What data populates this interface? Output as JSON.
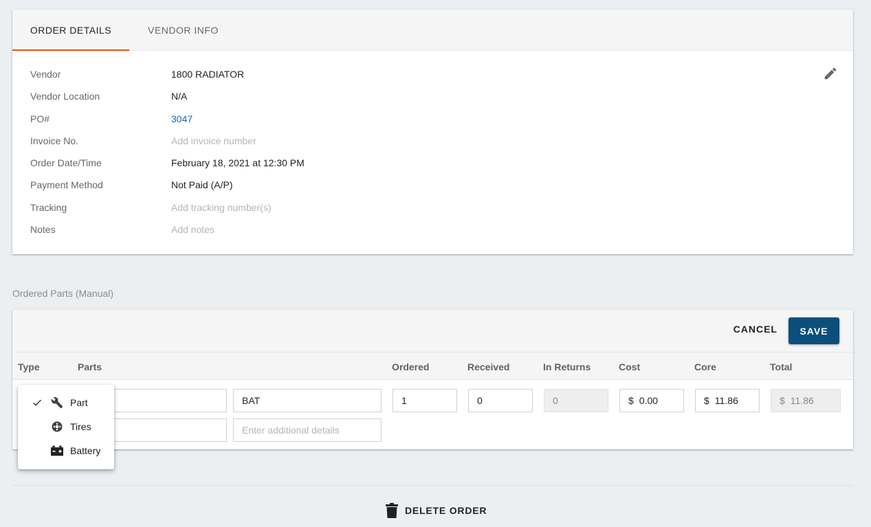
{
  "tabs": {
    "order_details": "ORDER DETAILS",
    "vendor_info": "VENDOR INFO"
  },
  "details": {
    "vendor_label": "Vendor",
    "vendor_value": "1800 RADIATOR",
    "location_label": "Vendor Location",
    "location_value": "N/A",
    "po_label": "PO#",
    "po_value": "3047",
    "invoice_label": "Invoice No.",
    "invoice_placeholder": "Add invoice number",
    "date_label": "Order Date/Time",
    "date_value": "February 18, 2021 at 12:30 PM",
    "payment_label": "Payment Method",
    "payment_value": "Not Paid (A/P)",
    "tracking_label": "Tracking",
    "tracking_placeholder": "Add tracking number(s)",
    "notes_label": "Notes",
    "notes_placeholder": "Add notes"
  },
  "section_label": "Ordered Parts (Manual)",
  "toolbar": {
    "cancel_label": "CANCEL",
    "save_label": "SAVE"
  },
  "columns": {
    "type": "Type",
    "parts": "Parts",
    "ordered": "Ordered",
    "received": "Received",
    "in_returns": "In Returns",
    "cost": "Cost",
    "core": "Core",
    "total": "Total"
  },
  "row": {
    "part_name": "BAT",
    "details_placeholder": "Enter additional details",
    "ordered": "1",
    "received": "0",
    "in_returns": "0",
    "currency": "$",
    "cost": "0.00",
    "core": "11.86",
    "total": "11.86"
  },
  "type_menu": {
    "items": [
      {
        "label": "Part",
        "icon": "wrench-icon",
        "selected": true
      },
      {
        "label": "Tires",
        "icon": "tire-icon",
        "selected": false
      },
      {
        "label": "Battery",
        "icon": "battery-icon",
        "selected": false
      }
    ]
  },
  "delete_label": "DELETE ORDER",
  "colors": {
    "accent_tab": "#e5531a",
    "primary_button": "#0b4f7c",
    "link": "#1565c0"
  }
}
